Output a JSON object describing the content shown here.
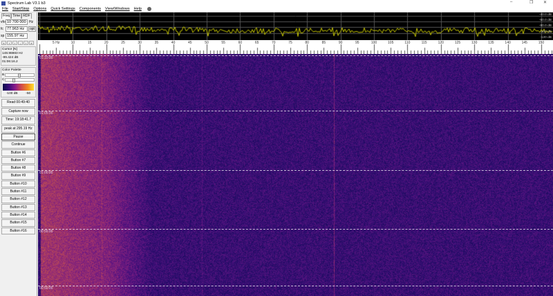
{
  "window": {
    "title": "Spectrum Lab V3.1 b3",
    "minimize": "–",
    "restore": "❐",
    "close": "✕"
  },
  "menu": [
    "File",
    "Start/Stop",
    "Options",
    "Quick Settings",
    "Components",
    "View/Windows",
    "Help"
  ],
  "tabs": [
    "Freq",
    "Time",
    "RDF"
  ],
  "fields": {
    "vfo_label": "vfo",
    "vfo": "10 700 000",
    "vfo_unit": "Hz",
    "fc_label": "fc",
    "fc": "77.963 Hz",
    "opt": "opt",
    "sp_label": "sp",
    "sp": "155.97 Hz"
  },
  "nav_buttons": [
    "«",
    "‹",
    "‹",
    "-",
    "›",
    "»"
  ],
  "cursor": {
    "title": "Cursor [N]",
    "freq": "148.98883 Hz",
    "level": "-99.424 dB",
    "time": "01:06:16.2"
  },
  "palette": {
    "title": "Color Palette",
    "b_label": "B",
    "c_label": "C",
    "min": "-100 dB",
    "max": "-50"
  },
  "buttons": [
    "Read 00:49:40",
    "Capture now",
    "Time:  19:18:41.7",
    "peak at 295.19 Hz",
    "Pause",
    "Continue",
    "Button #6",
    "Button #7",
    "Button #8",
    "Button #9",
    "Button #10",
    "Button #11",
    "Button #12",
    "Button #13",
    "Button #14",
    "Button #15",
    "Button #16"
  ],
  "spectrum": {
    "db_labels": [
      "-40.0 dB",
      "-60.0 dB",
      "-80.0 dB",
      "-100 dB",
      "-120 dB"
    ]
  },
  "freq_scale": {
    "labels": [
      "5 Hz",
      "10",
      "15",
      "20",
      "25",
      "30",
      "35",
      "40",
      "45",
      "50",
      "55",
      "60",
      "65",
      "70",
      "75",
      "80",
      "85",
      "90",
      "95",
      "100",
      "105",
      "110",
      "115",
      "120",
      "125",
      "130",
      "135",
      "140",
      "145",
      "150"
    ]
  },
  "waterfall": {
    "timestamps": [
      "01:10:00",
      "01:05:00",
      "01:00:00",
      "00:55:00",
      "00:50:00"
    ]
  },
  "colors": {
    "trace": "#c8c800",
    "grid": "#555555",
    "marker": "#d03060"
  }
}
